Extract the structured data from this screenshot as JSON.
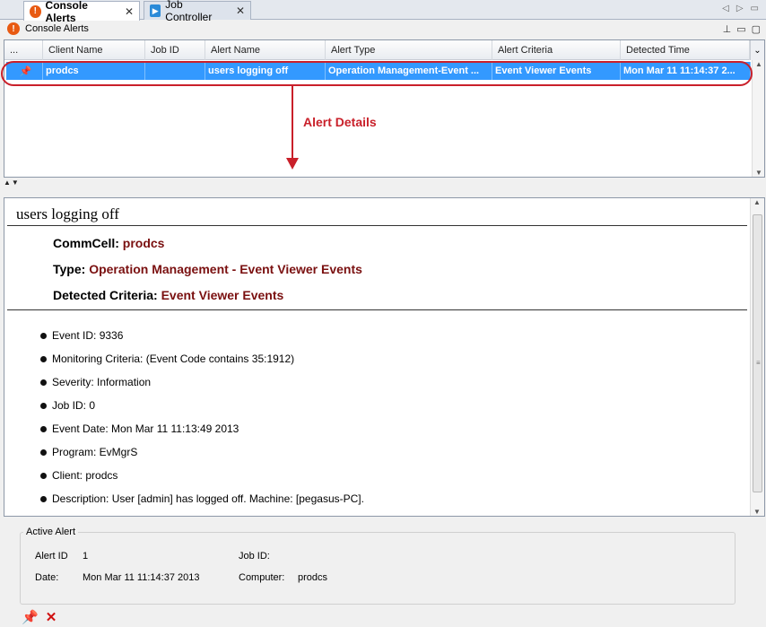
{
  "tabs": [
    {
      "label": "Console Alerts",
      "icon": "alert-icon",
      "active": true
    },
    {
      "label": "Job Controller",
      "icon": "job-controller-icon",
      "active": false
    }
  ],
  "view": {
    "title": "Console Alerts"
  },
  "table": {
    "columns": [
      "...",
      "Client Name",
      "Job ID",
      "Alert Name",
      "Alert Type",
      "Alert Criteria",
      "Detected Time"
    ],
    "rows": [
      {
        "pin": "pin-icon",
        "client": "prodcs",
        "job_id": "",
        "alert_name": "users logging off",
        "alert_type": "Operation Management-Event ...",
        "criteria": "Event Viewer Events",
        "time": "Mon Mar 11 11:14:37 2..."
      }
    ]
  },
  "annotation": {
    "label": "Alert Details",
    "color": "#c9202a"
  },
  "details": {
    "title": "users logging off",
    "commcell_label": "CommCell:",
    "commcell_value": "prodcs",
    "type_label": "Type:",
    "type_value": "Operation Management - Event Viewer Events",
    "criteria_label": "Detected Criteria:",
    "criteria_value": "Event Viewer Events",
    "items": [
      "Event ID: 9336",
      "Monitoring Criteria: (Event Code contains 35:1912)",
      "Severity: Information",
      "Job ID: 0",
      "Event Date: Mon Mar 11 11:13:49 2013",
      "Program: EvMgrS",
      "Client: prodcs",
      "Description: User [admin] has logged off. Machine: [pegasus-PC]."
    ]
  },
  "active_alert": {
    "title": "Active Alert",
    "alert_id_label": "Alert ID",
    "alert_id": "1",
    "job_id_label": "Job ID:",
    "job_id": "",
    "date_label": "Date:",
    "date": "Mon Mar 11 11:14:37 2013",
    "computer_label": "Computer:",
    "computer": "prodcs"
  },
  "colors": {
    "selection": "#3399ff",
    "accent_value": "#7a1010"
  }
}
